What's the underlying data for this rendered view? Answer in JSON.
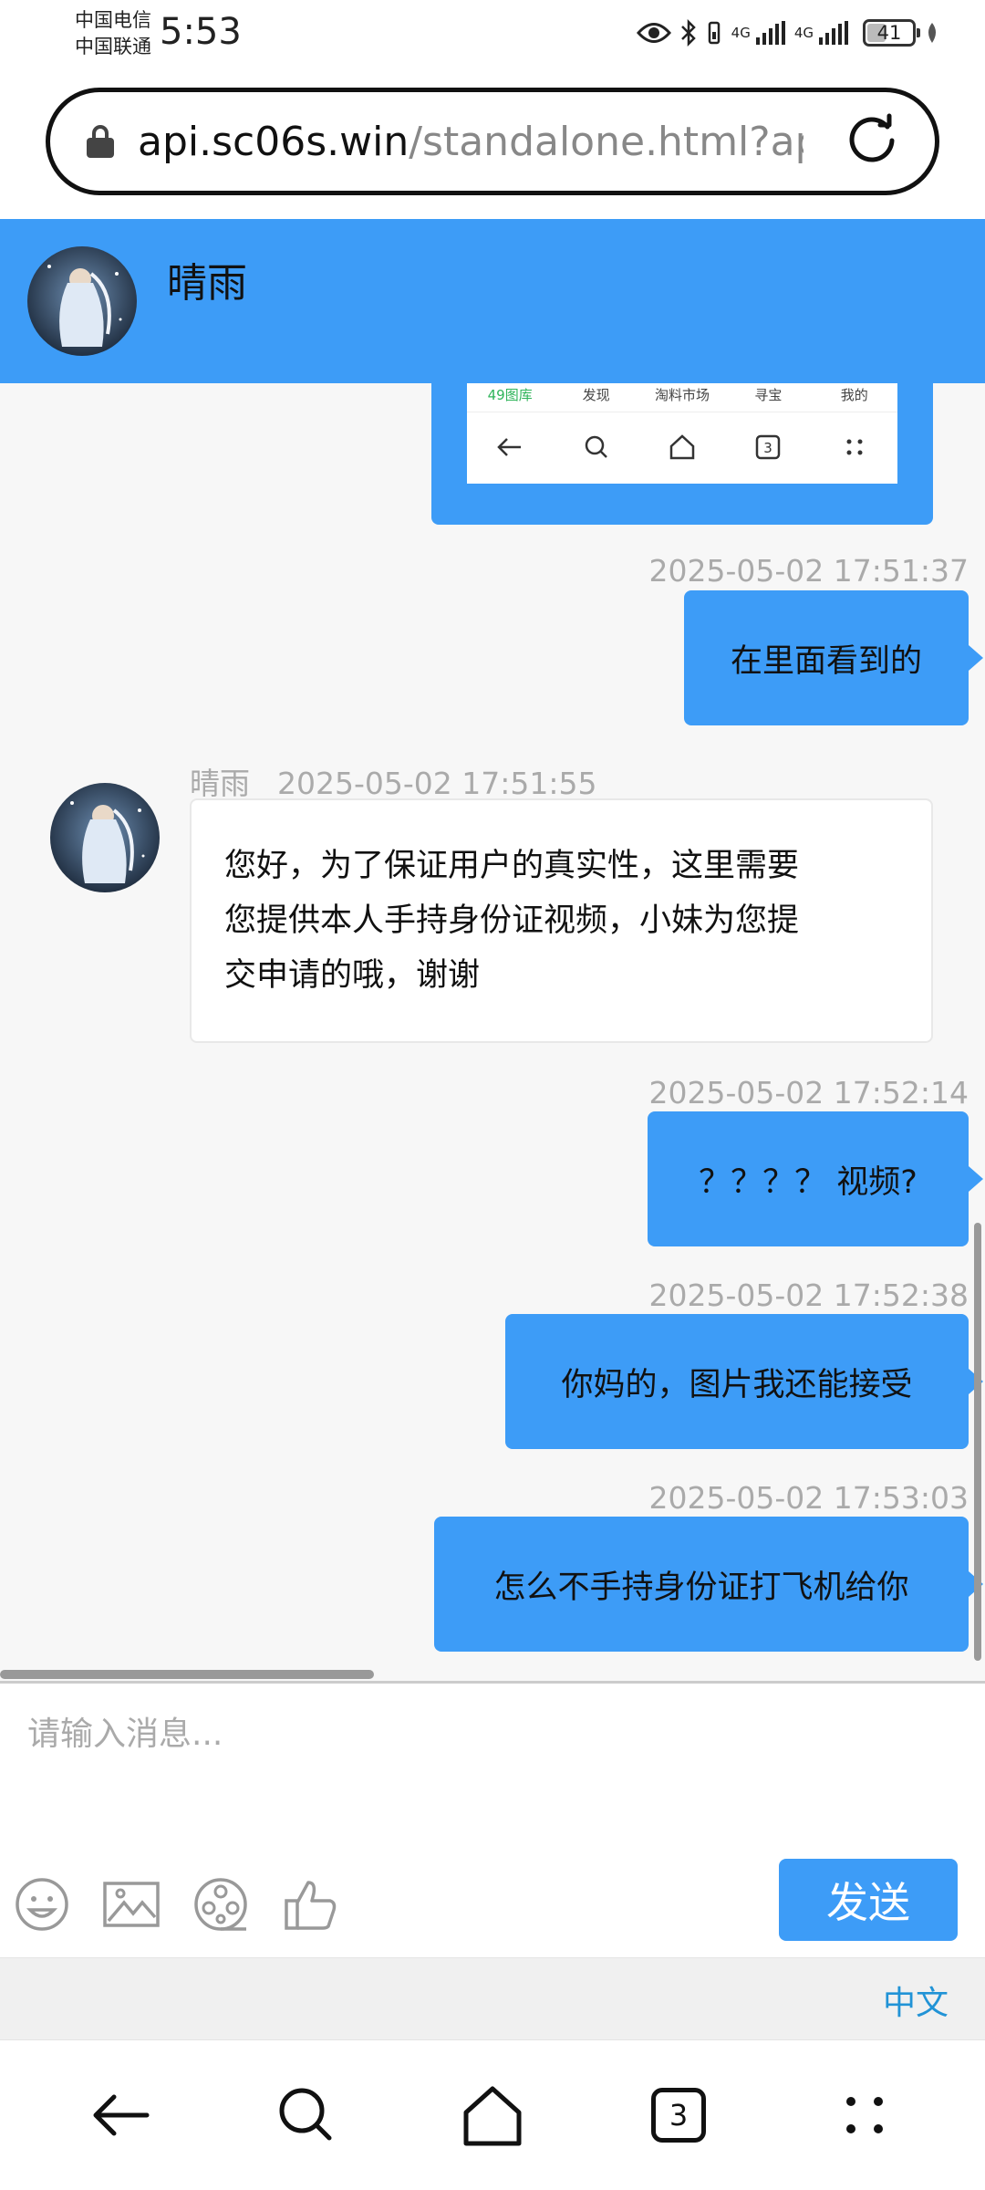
{
  "status_bar": {
    "carrier_1": "中国电信",
    "carrier_2": "中国联通",
    "time": "5:53",
    "signal_1": "4G",
    "signal_2": "4G",
    "battery": "41",
    "battery_level": 0.41
  },
  "browser": {
    "url_host": "api.sc06s.win",
    "url_path": "/standalone.html?ap",
    "tab_count": "3"
  },
  "chat_header": {
    "name": "晴雨"
  },
  "embedded_screenshot": {
    "tabs": [
      "49图库",
      "发现",
      "淘料市场",
      "寻宝",
      "我的"
    ],
    "tab_count": "3"
  },
  "messages": [
    {
      "time": "2025-05-02 17:51:37",
      "text": "在里面看到的"
    },
    {
      "sender": "晴雨",
      "time": "2025-05-02 17:51:55",
      "lines": [
        "您好，为了保证用户的真实性，这里需要",
        "您提供本人手持身份证视频，小妹为您提",
        "交申请的哦，谢谢"
      ]
    },
    {
      "time": "2025-05-02 17:52:14",
      "text": "？？？？ 视频?"
    },
    {
      "time": "2025-05-02 17:52:38",
      "text": "你妈的，图片我还能接受"
    },
    {
      "time": "2025-05-02 17:53:03",
      "text": "怎么不手持身份证打飞机给你"
    }
  ],
  "composer": {
    "placeholder": "请输入消息...",
    "send_label": "发送"
  },
  "ime": {
    "language": "中文"
  },
  "colors": {
    "accent": "#3d9cf7",
    "ime_link": "#2193d6"
  }
}
